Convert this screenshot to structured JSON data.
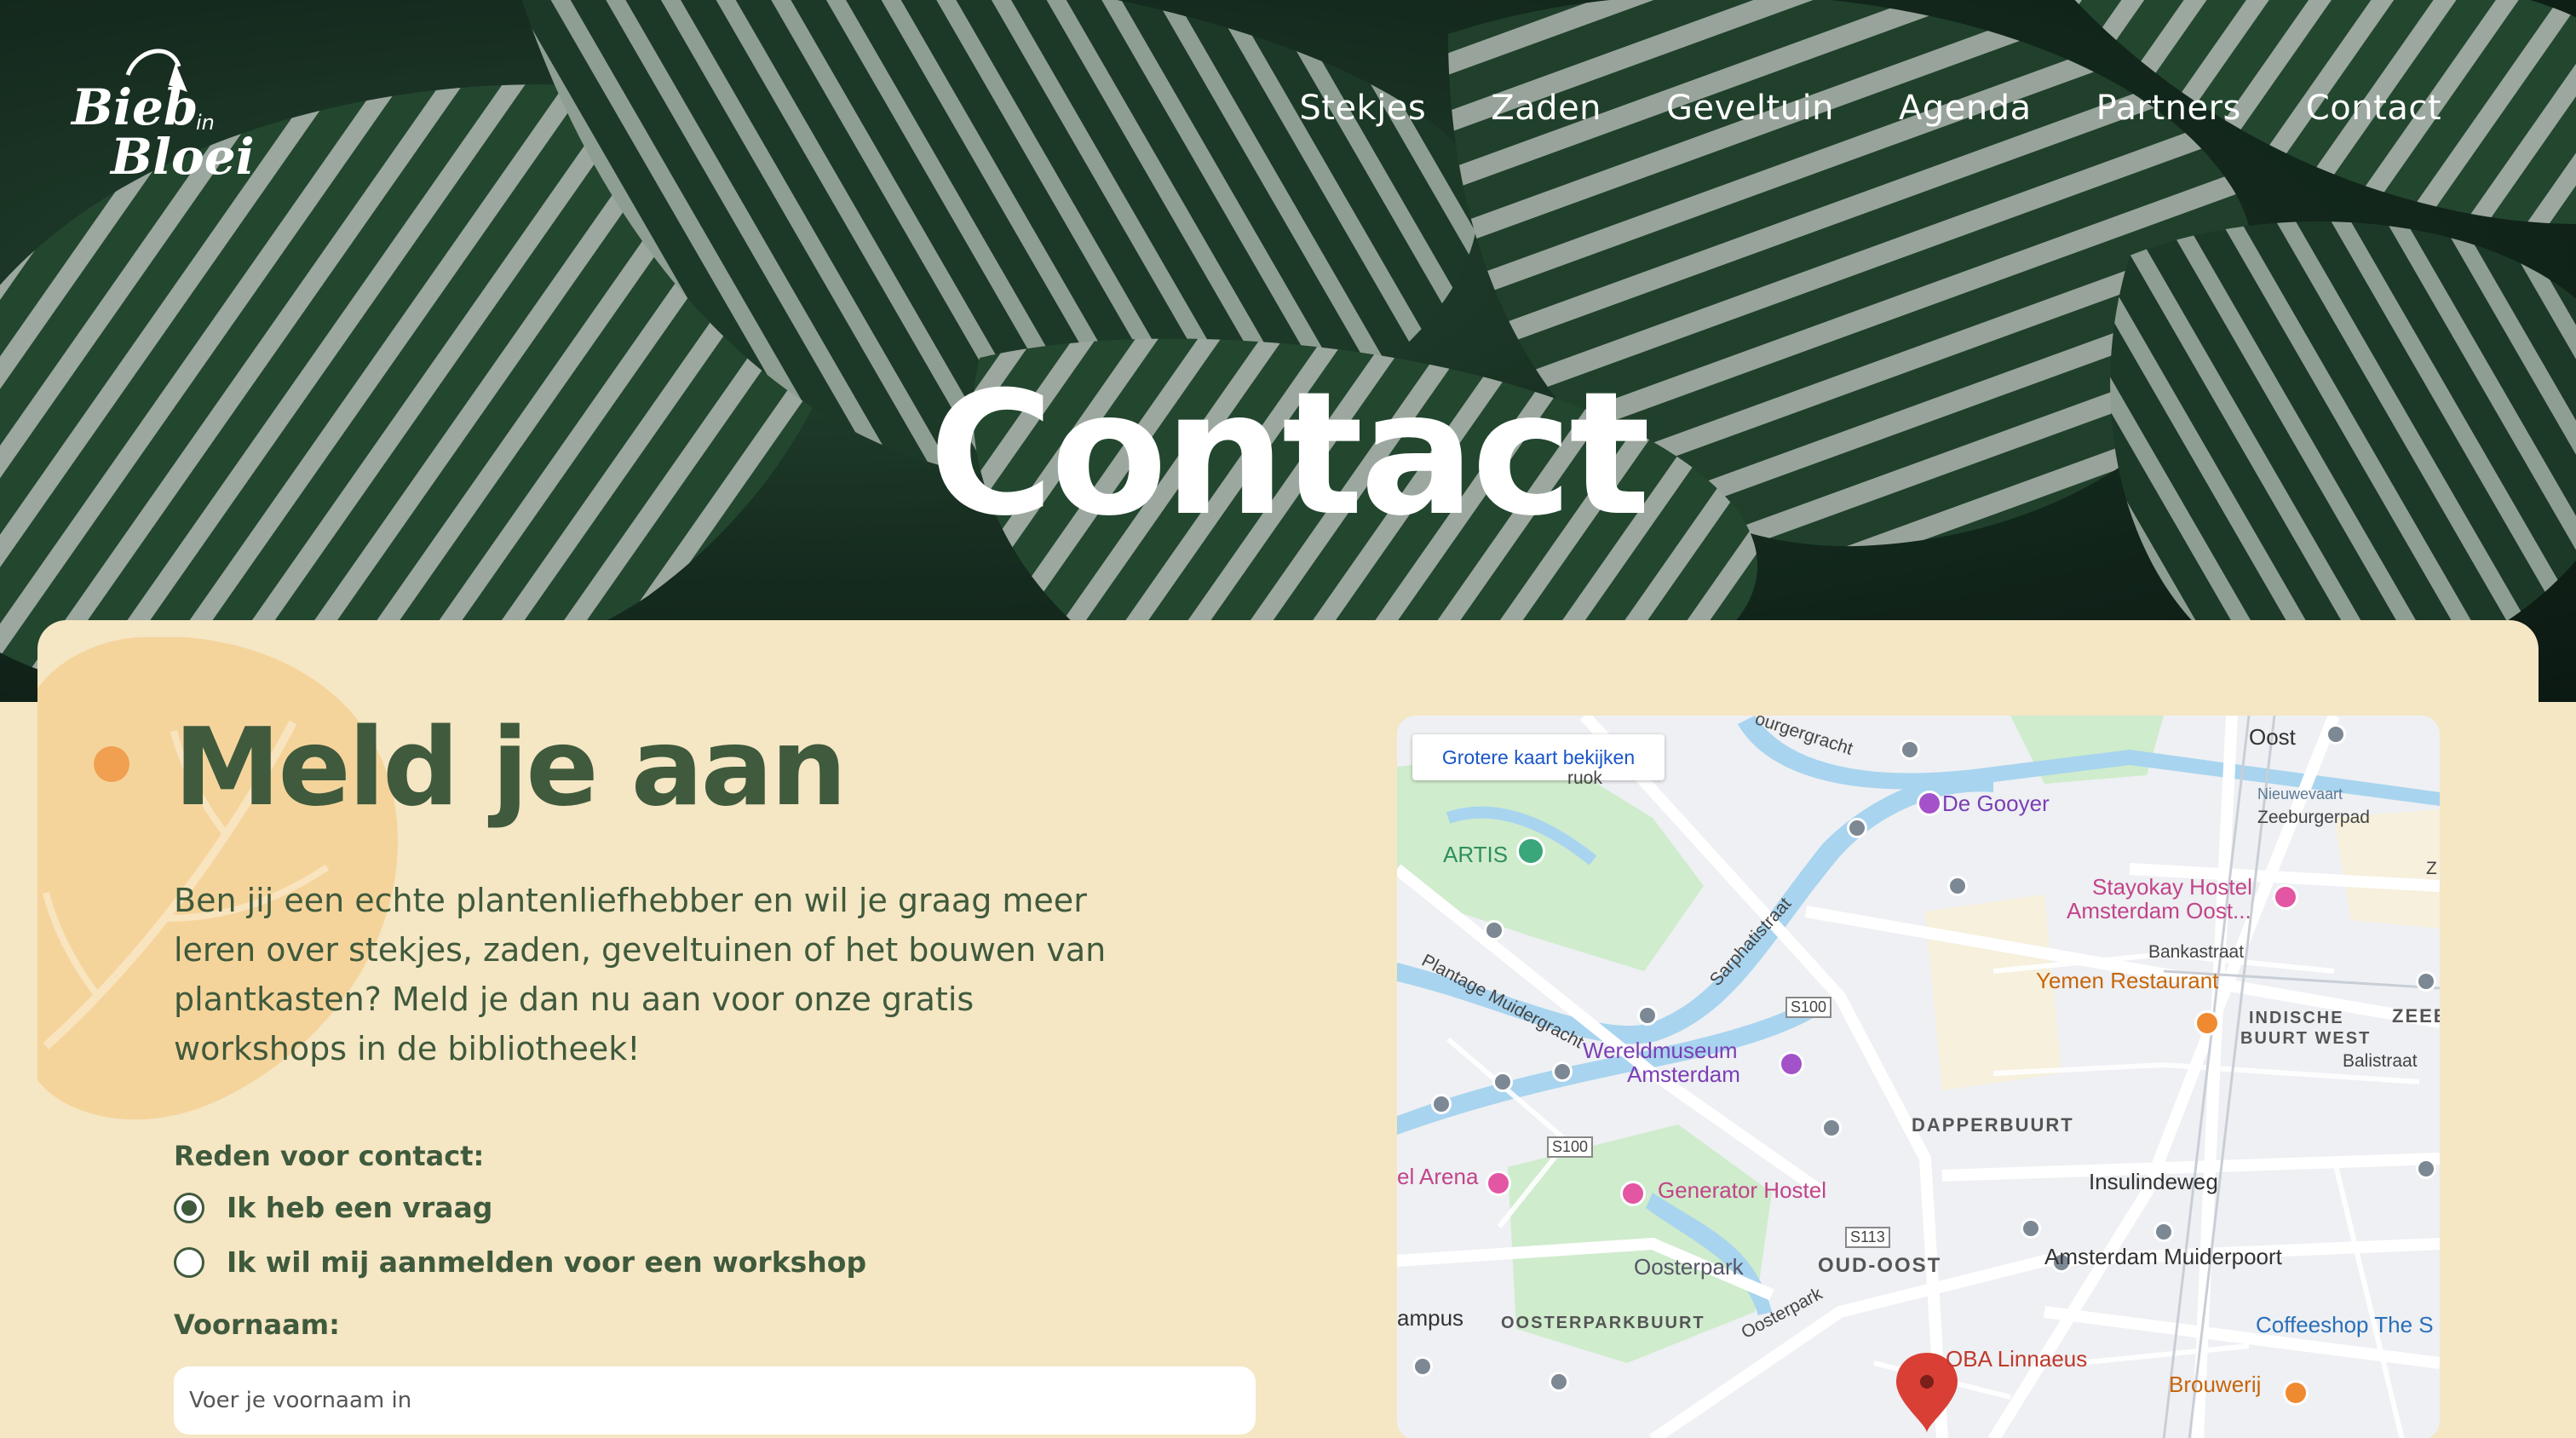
{
  "site": {
    "logo_text": "Bieb in Bloei",
    "nav": [
      "Stekjes",
      "Zaden",
      "Geveltuin",
      "Agenda",
      "Partners",
      "Contact"
    ]
  },
  "hero": {
    "title": "Contact"
  },
  "form": {
    "title": "Meld je aan",
    "intro": "Ben jij een echte plantenliefhebber en wil je graag meer leren over stekjes, zaden, geveltuinen of het bouwen van plantkasten? Meld je dan nu aan voor onze gratis workshops in de bibliotheek!",
    "reason_label": "Reden voor contact:",
    "options": [
      {
        "label": "Ik heb een vraag",
        "selected": true
      },
      {
        "label": "Ik wil mij aanmelden voor een workshop",
        "selected": false
      }
    ],
    "firstname_label": "Voornaam:",
    "firstname_placeholder": "Voer je voornaam in",
    "firstname_value": ""
  },
  "map": {
    "larger_map_button": "Grotere kaart bekijken",
    "labels": {
      "poi_gooyer": "De Gooyer",
      "artis": "ARTIS",
      "oost": "Oost",
      "nieuwevaart": "Nieuwevaart",
      "zeeburgerpad": "Zeeburgerpad",
      "stayokay": "Stayokay Hostel",
      "stayokay2": "Amsterdam Oost...",
      "bankastraat": "Bankastraat",
      "yemen": "Yemen Restaurant",
      "indische": "INDISCHE",
      "buurt_west": "BUURT WEST",
      "zeeb": "ZEEB",
      "balistraat": "Balistraat",
      "plantage": "Plantage Muidergracht",
      "sarphatistraat": "Sarphatistraat",
      "s100a": "S100",
      "s100b": "S100",
      "s113": "S113",
      "wereld1": "Wereldmuseum",
      "wereld2": "Amsterdam",
      "dapperbuurt": "DAPPERBUURT",
      "arena": "el Arena",
      "generator": "Generator Hostel",
      "insulindeweg": "Insulindeweg",
      "oosterpark": "Oosterpark",
      "oudoost": "OUD-OOST",
      "muiderpoort": "Amsterdam Muiderpoort",
      "campus": "ampus",
      "oosterparkbuurt": "OOSTERPARKBUURT",
      "oosterpark_street": "Oosterpark",
      "coffeeshop": "Coffeeshop The S",
      "oba": "OBA Linnaeus",
      "brouwerij": "Brouwerij",
      "gracht": "ourgergracht",
      "ruok": "ruok",
      "z_edge": "Z"
    },
    "colors": {
      "water": "#a8d4ef",
      "park": "#cfeccc",
      "road": "#ffffff",
      "land": "#eef0f3"
    }
  },
  "colors": {
    "brand_green": "#3f5a3c",
    "card_bg": "#f5e6c4",
    "accent_orange": "#f0a050",
    "leaf_light": "#f5d49c"
  }
}
